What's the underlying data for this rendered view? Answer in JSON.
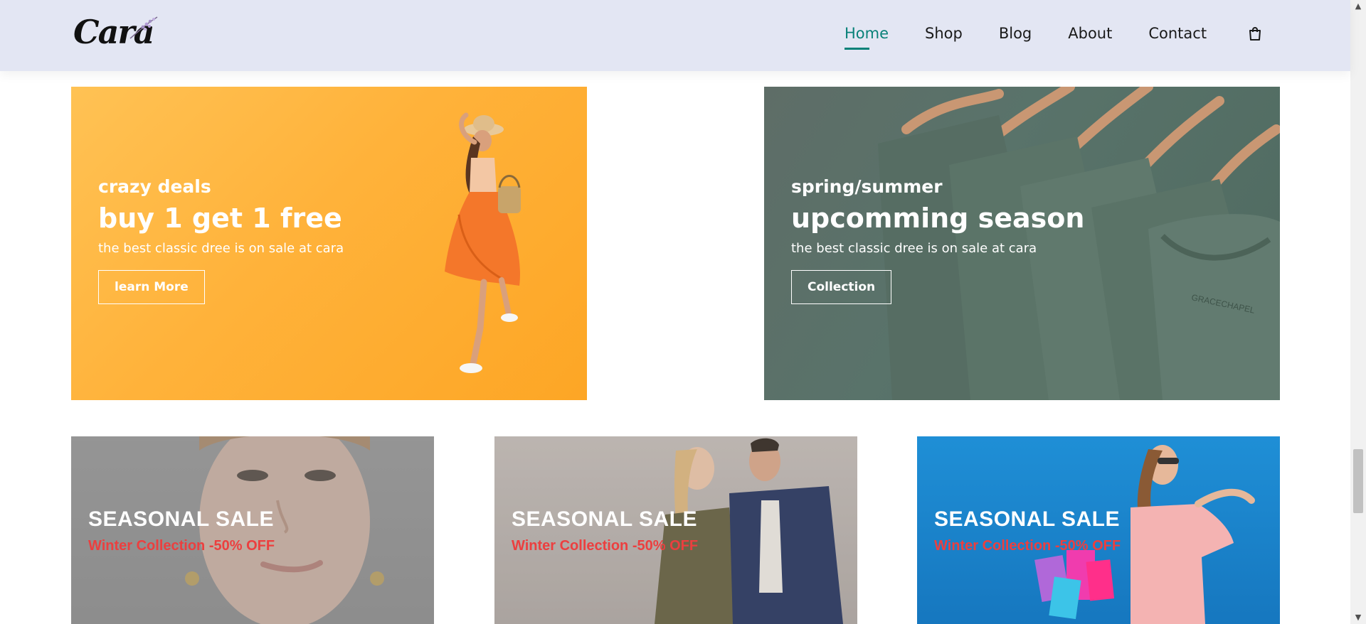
{
  "header": {
    "logo_text": "Cara",
    "nav": [
      {
        "label": "Home",
        "active": true
      },
      {
        "label": "Shop",
        "active": false
      },
      {
        "label": "Blog",
        "active": false
      },
      {
        "label": "About",
        "active": false
      },
      {
        "label": "Contact",
        "active": false
      }
    ],
    "cart_icon": "shopping-bag-icon"
  },
  "banners_big": [
    {
      "subtitle": "crazy deals",
      "title": "buy 1 get 1 free",
      "description": "the best classic dree is on sale at cara",
      "button_label": "learn More",
      "background": "#ffb23a"
    },
    {
      "subtitle": "spring/summer",
      "title": "upcomming season",
      "description": "the best classic dree is on sale at cara",
      "button_label": "Collection",
      "background": "#5a6f66"
    }
  ],
  "banners_small": [
    {
      "title": "SEASONAL SALE",
      "description": "Winter Collection -50% OFF",
      "background": "#949494"
    },
    {
      "title": "SEASONAL SALE",
      "description": "Winter Collection -50% OFF",
      "background": "#b3aca8"
    },
    {
      "title": "SEASONAL SALE",
      "description": "Winter Collection -50% OFF",
      "background": "#1b84cb"
    }
  ],
  "colors": {
    "accent": "#088178",
    "header_bg": "#e3e6f3",
    "sale_red": "#ec3f3f"
  }
}
